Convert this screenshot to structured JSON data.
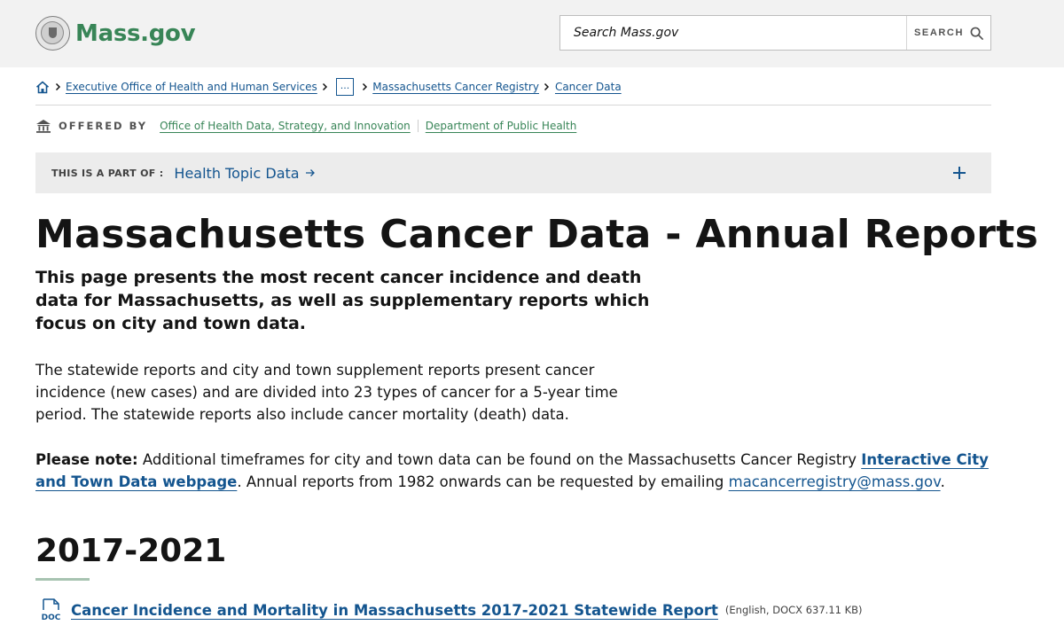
{
  "header": {
    "brand": "Mass.gov",
    "search_placeholder": "Search Mass.gov",
    "search_button_label": "SEARCH"
  },
  "breadcrumb": {
    "items": [
      "Executive Office of Health and Human Services",
      "...",
      "Massachusetts Cancer Registry",
      "Cancer Data"
    ]
  },
  "offered_by": {
    "label": "OFFERED BY",
    "orgs": [
      "Office of Health Data, Strategy, and Innovation",
      "Department of Public Health"
    ]
  },
  "part_of": {
    "label": "THIS IS A PART OF :",
    "link": "Health Topic Data"
  },
  "main": {
    "title": "Massachusetts Cancer Data - Annual Reports",
    "lede": "This page presents the most recent cancer incidence and death data for Massachusetts, as well as supplementary reports which focus on city and town data.",
    "paragraph": "The statewide reports and city and town supplement reports present cancer incidence (new cases) and are divided into 23 types of cancer for a 5-year time period. The statewide reports also include cancer mortality (death) data.",
    "note": {
      "label": "Please note:",
      "text_before": " Additional timeframes for city and town data can be found on the Massachusetts Cancer Registry ",
      "link_text": "Interactive City and Town Data webpage",
      "text_middle": ". Annual reports from 1982 onwards can be requested by emailing ",
      "email": "macancerregistry@mass.gov",
      "text_after": "."
    },
    "section": {
      "heading": "2017-2021",
      "documents": [
        {
          "icon_label": "DOC",
          "title": "Cancer Incidence and Mortality in Massachusetts 2017-2021 Statewide Report",
          "meta": "(English, DOCX 637.11 KB)"
        }
      ]
    }
  },
  "colors": {
    "brand_green": "#388557",
    "link_blue": "#14558f",
    "header_bg": "#f2f2f2",
    "partof_bg": "#ececec"
  }
}
